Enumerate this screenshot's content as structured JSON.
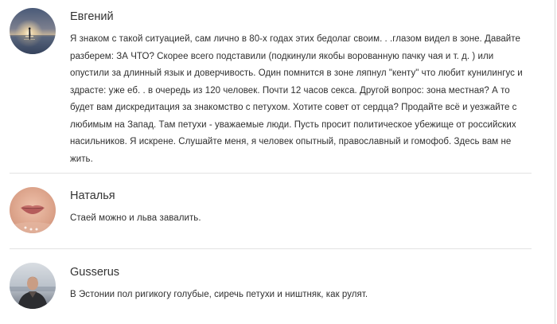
{
  "comments": [
    {
      "author": "Евгений",
      "avatar_icon": "user-avatar-sunset-photo",
      "text": "Я знаком с такой ситуацией, сам лично в 80-х годах этих бедолаг своим. . .глазом видел в зоне. Давайте разберем: ЗА ЧТО? Скорее всего подставили (подкинули якобы ворованную пачку чая и т. д. ) или опустили за длинный язык и доверчивость. Один помнится в зоне ляпнул \"кенту\" что любит кунилингус и здрасте: уже еб. . в очередь из 120 человек. Почти 12 часов секса. Другой вопрос: зона местная? А то будет вам дискредитация за знакомство с петухом. Хотите совет от сердца? Продайте всё и уезжайте с любимым на Запад. Там петухи - уважаемые люди. Пусть просит политическое убежище от российских насильников. Я искрене. Слушайте меня, я человек опытный, православный и гомофоб. Здесь вам не жить."
    },
    {
      "author": "Наталья",
      "avatar_icon": "user-avatar-lips-photo",
      "text": "Стаей можно и льва завалить."
    },
    {
      "author": "Gusserus",
      "avatar_icon": "user-avatar-man-photo",
      "text": "В Эстонии пол ригикогу голубые, сиречь петухи и ништняк, как рулят."
    }
  ],
  "colors": {
    "text": "#2f2f2f",
    "author": "#333333",
    "divider": "#e3e3e3",
    "background": "#ffffff"
  }
}
